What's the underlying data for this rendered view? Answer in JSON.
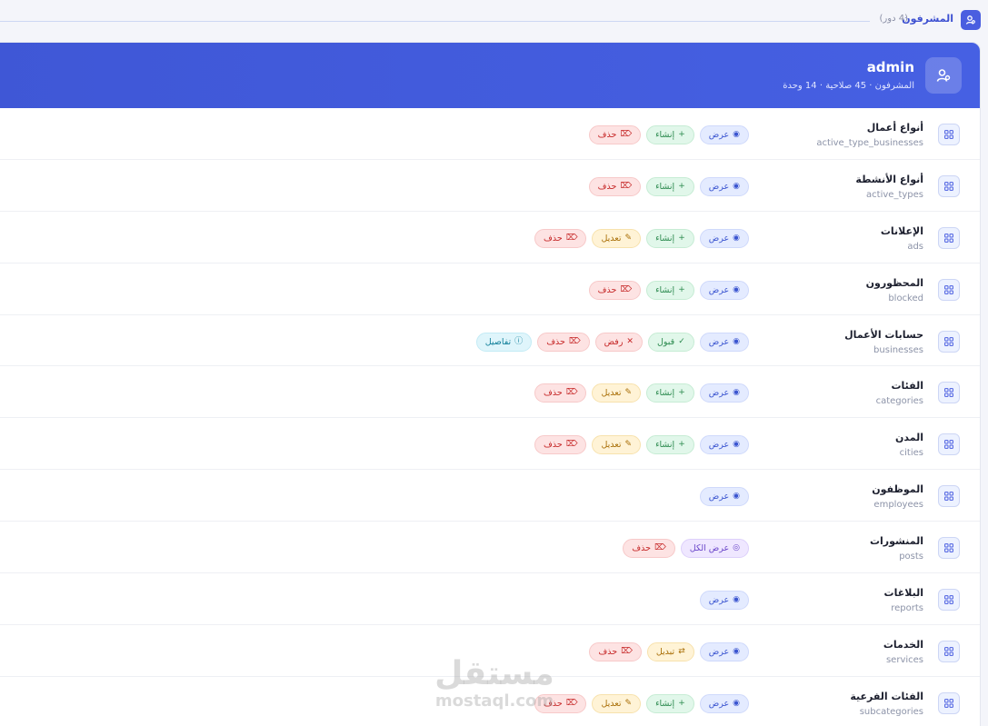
{
  "section": {
    "title": "المشرفون",
    "count": "(4 دور)"
  },
  "role": {
    "name": "admin",
    "meta": "المشرفون · 45 صلاحية · 14 وحدة"
  },
  "icons": {
    "section": "user-group-icon",
    "role": "user-group-icon",
    "row": "grid-icon",
    "view": "eye-icon",
    "create": "plus-icon",
    "edit": "pencil-icon",
    "delete": "trash-icon",
    "accept": "check-icon",
    "reject": "x-icon",
    "details": "info-icon",
    "switch": "shuffle-icon"
  },
  "colors": {
    "accent": "#4660e3",
    "view": "#3b55d0",
    "create": "#2b8a4e",
    "edit": "#a86d05",
    "delete": "#c62828",
    "details": "#0f7e99",
    "view_all": "#6a46c9"
  },
  "modules": [
    {
      "title": "أنواع أعمال",
      "key": "active_type_businesses",
      "perms": [
        {
          "type": "view",
          "label": "عرض"
        },
        {
          "type": "create",
          "label": "إنشاء"
        },
        {
          "type": "delete",
          "label": "حذف"
        }
      ]
    },
    {
      "title": "أنواع الأنشطة",
      "key": "active_types",
      "perms": [
        {
          "type": "view",
          "label": "عرض"
        },
        {
          "type": "create",
          "label": "إنشاء"
        },
        {
          "type": "delete",
          "label": "حذف"
        }
      ]
    },
    {
      "title": "الإعلانات",
      "key": "ads",
      "perms": [
        {
          "type": "view",
          "label": "عرض"
        },
        {
          "type": "create",
          "label": "إنشاء"
        },
        {
          "type": "edit",
          "label": "تعديل"
        },
        {
          "type": "delete",
          "label": "حذف"
        }
      ]
    },
    {
      "title": "المحظورون",
      "key": "blocked",
      "perms": [
        {
          "type": "view",
          "label": "عرض"
        },
        {
          "type": "create",
          "label": "إنشاء"
        },
        {
          "type": "delete",
          "label": "حذف"
        }
      ]
    },
    {
      "title": "حسابات الأعمال",
      "key": "businesses",
      "perms": [
        {
          "type": "view",
          "label": "عرض"
        },
        {
          "type": "accept",
          "label": "قبول"
        },
        {
          "type": "reject",
          "label": "رفض"
        },
        {
          "type": "delete",
          "label": "حذف"
        },
        {
          "type": "details",
          "label": "تفاصيل"
        }
      ]
    },
    {
      "title": "الفئات",
      "key": "categories",
      "perms": [
        {
          "type": "view",
          "label": "عرض"
        },
        {
          "type": "create",
          "label": "إنشاء"
        },
        {
          "type": "edit",
          "label": "تعديل"
        },
        {
          "type": "delete",
          "label": "حذف"
        }
      ]
    },
    {
      "title": "المدن",
      "key": "cities",
      "perms": [
        {
          "type": "view",
          "label": "عرض"
        },
        {
          "type": "create",
          "label": "إنشاء"
        },
        {
          "type": "edit",
          "label": "تعديل"
        },
        {
          "type": "delete",
          "label": "حذف"
        }
      ]
    },
    {
      "title": "الموظفون",
      "key": "employees",
      "perms": [
        {
          "type": "view",
          "label": "عرض"
        }
      ]
    },
    {
      "title": "المنشورات",
      "key": "posts",
      "perms": [
        {
          "type": "viewall",
          "label": "عرض الكل"
        },
        {
          "type": "delete",
          "label": "حذف"
        }
      ]
    },
    {
      "title": "البلاغات",
      "key": "reports",
      "perms": [
        {
          "type": "view",
          "label": "عرض"
        }
      ]
    },
    {
      "title": "الخدمات",
      "key": "services",
      "perms": [
        {
          "type": "view",
          "label": "عرض"
        },
        {
          "type": "switch",
          "label": "تبديل"
        },
        {
          "type": "delete",
          "label": "حذف"
        }
      ]
    },
    {
      "title": "الفئات الفرعية",
      "key": "subcategories",
      "perms": [
        {
          "type": "view",
          "label": "عرض"
        },
        {
          "type": "create",
          "label": "إنشاء"
        },
        {
          "type": "edit",
          "label": "تعديل"
        },
        {
          "type": "delete",
          "label": "حذف"
        }
      ]
    }
  ],
  "watermark": {
    "arabic": "مستقل",
    "latin": "mostaql.com"
  }
}
